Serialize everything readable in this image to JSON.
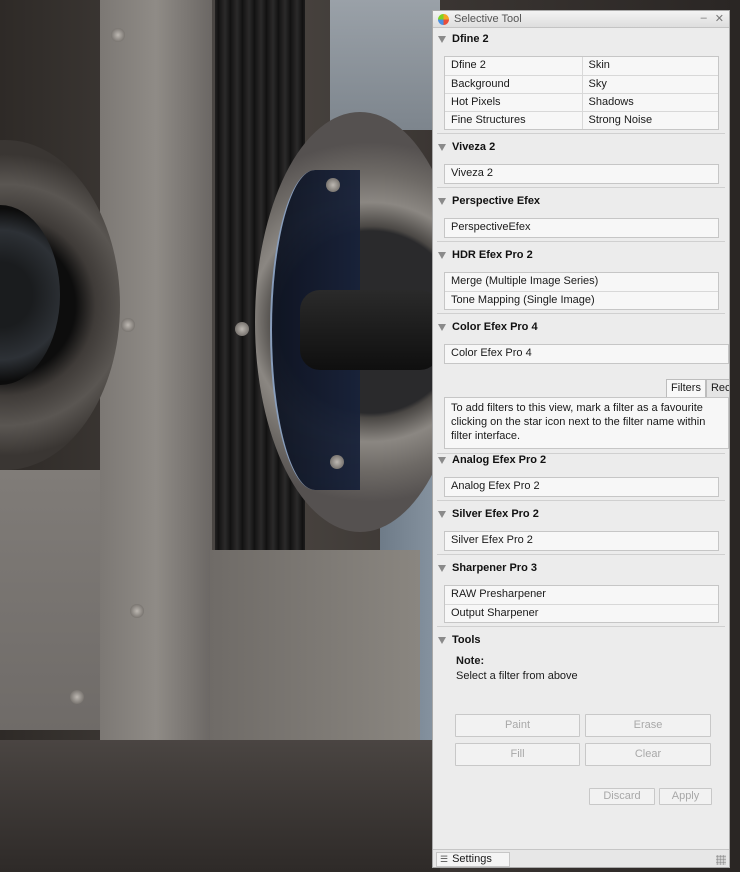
{
  "window": {
    "title": "Selective Tool"
  },
  "sections": {
    "dfine": {
      "title": "Dfine 2",
      "grid": [
        [
          "Dfine 2",
          "Skin"
        ],
        [
          "Background",
          "Sky"
        ],
        [
          "Hot Pixels",
          "Shadows"
        ],
        [
          "Fine Structures",
          "Strong Noise"
        ]
      ]
    },
    "viveza": {
      "title": "Viveza 2",
      "items": [
        "Viveza 2"
      ]
    },
    "perspective": {
      "title": "Perspective Efex",
      "items": [
        "PerspectiveEfex"
      ]
    },
    "hdr": {
      "title": "HDR Efex Pro 2",
      "items": [
        "Merge (Multiple Image Series)",
        "Tone Mapping (Single Image)"
      ]
    },
    "color": {
      "title": "Color Efex Pro 4",
      "items": [
        "Color Efex Pro 4"
      ],
      "tabs": [
        "Filters",
        "Rec"
      ],
      "info": "To add filters to this view, mark a filter as a favourite\nclicking on the star icon next to the filter name within\nfilter interface."
    },
    "analog": {
      "title": "Analog Efex Pro 2",
      "items": [
        "Analog Efex Pro 2"
      ]
    },
    "silver": {
      "title": "Silver Efex Pro 2",
      "items": [
        "Silver Efex Pro 2"
      ]
    },
    "sharpener": {
      "title": "Sharpener Pro 3",
      "items": [
        "RAW Presharpener",
        "Output Sharpener"
      ]
    },
    "tools": {
      "title": "Tools",
      "note_title": "Note:",
      "note_text": "Select a filter from above",
      "paint": "Paint",
      "erase": "Erase",
      "fill": "Fill",
      "clear": "Clear",
      "discard": "Discard",
      "apply": "Apply"
    }
  },
  "statusbar": {
    "settings_label": "Settings"
  },
  "icons": {
    "app": "nik-collection-icon",
    "settings": "list-icon",
    "grip": "resize-grip-icon"
  },
  "colors": {
    "panel_bg": "#ececec",
    "disabled_text": "#a8a8a8",
    "border": "#c6c6c6"
  }
}
